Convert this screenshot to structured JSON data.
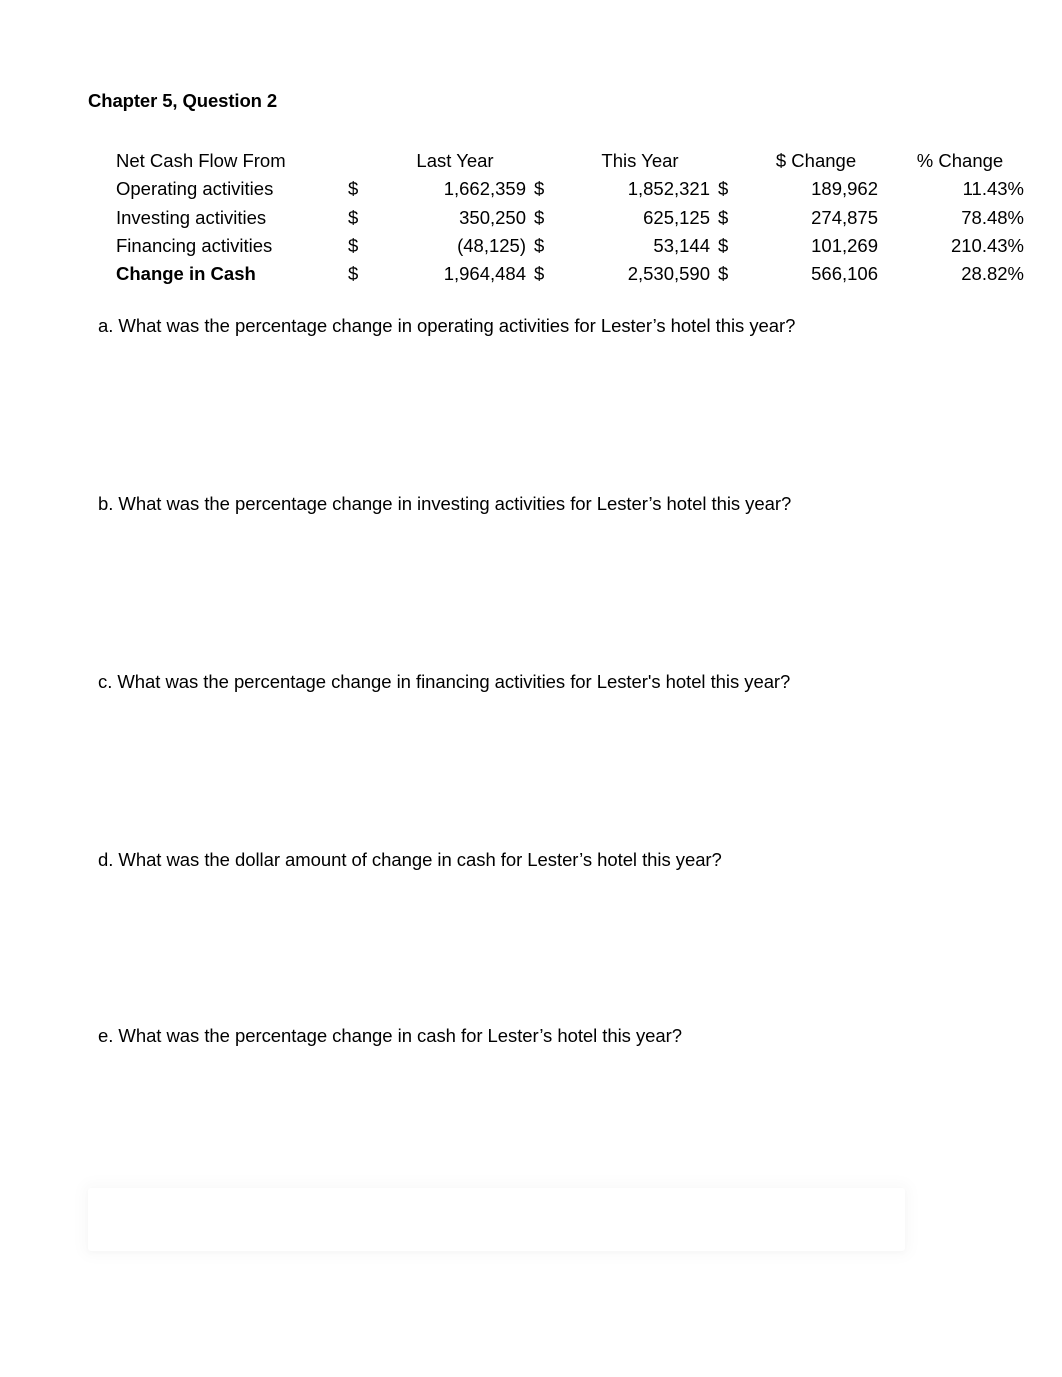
{
  "document": {
    "title": "Chapter 5, Question 2"
  },
  "table": {
    "headers": {
      "label": "Net Cash Flow From",
      "last_year": "Last Year",
      "this_year": "This Year",
      "dollar_change": "$ Change",
      "percent_change": "% Change"
    },
    "currency_symbol": "$",
    "rows": [
      {
        "label": "Operating activities",
        "last_year": "1,662,359",
        "this_year": "1,852,321",
        "dollar_change": "189,962",
        "percent_change": "11.43%"
      },
      {
        "label": "Investing activities",
        "last_year": "350,250",
        "this_year": "625,125",
        "dollar_change": "274,875",
        "percent_change": "78.48%"
      },
      {
        "label": "Financing activities",
        "last_year": "(48,125)",
        "this_year": "53,144",
        "dollar_change": "101,269",
        "percent_change": "210.43%"
      },
      {
        "label": "Change in Cash",
        "last_year": "1,964,484",
        "this_year": "2,530,590",
        "dollar_change": "566,106",
        "percent_change": "28.82%"
      }
    ]
  },
  "questions": [
    {
      "text": "a. What was the percentage change in operating activities for Lester’s hotel this year?"
    },
    {
      "text": "b. What was the percentage change in investing activities for Lester’s hotel this year?"
    },
    {
      "text": "c. What was the percentage change in financing activities for Lester's hotel this year?"
    },
    {
      "text": "d. What was the dollar amount of change in cash for Lester’s hotel this year?"
    },
    {
      "text": "e. What was the percentage change in cash for Lester’s hotel this year?"
    }
  ]
}
